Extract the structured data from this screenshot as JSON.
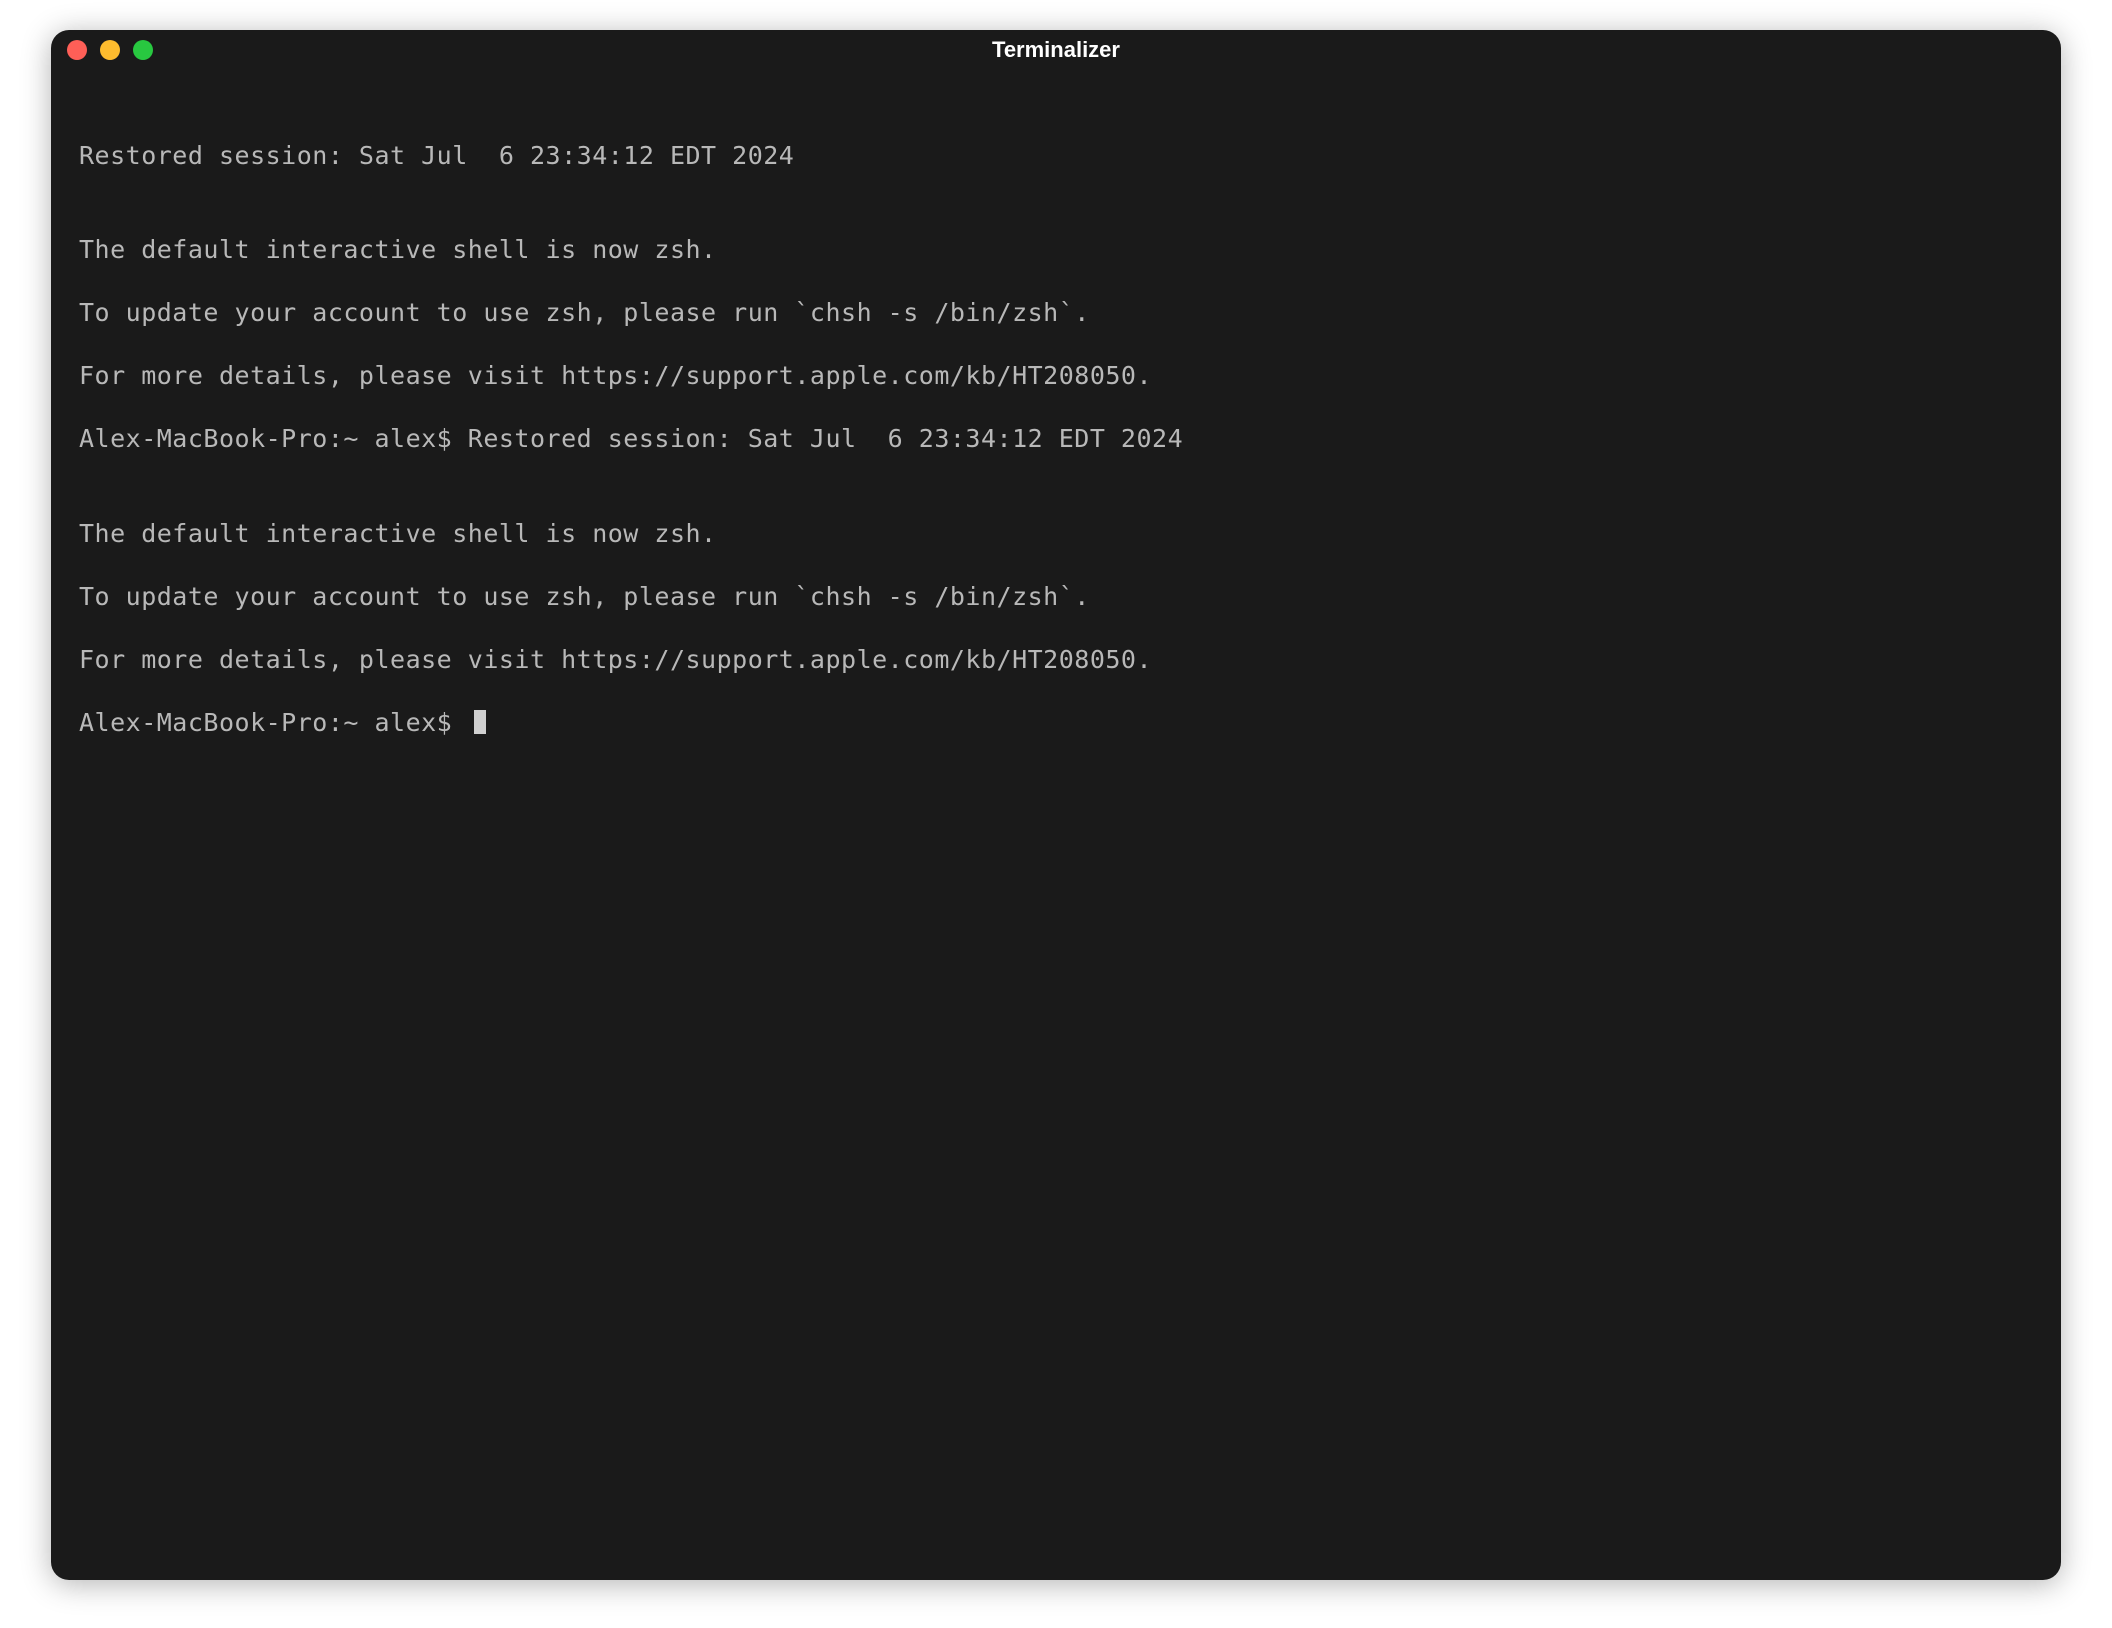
{
  "window": {
    "title": "Terminalizer"
  },
  "terminal": {
    "lines": [
      "Restored session: Sat Jul  6 23:34:12 EDT 2024",
      "",
      "The default interactive shell is now zsh.",
      "To update your account to use zsh, please run `chsh -s /bin/zsh`.",
      "For more details, please visit https://support.apple.com/kb/HT208050.",
      "Alex-MacBook-Pro:~ alex$ Restored session: Sat Jul  6 23:34:12 EDT 2024",
      "",
      "The default interactive shell is now zsh.",
      "To update your account to use zsh, please run `chsh -s /bin/zsh`.",
      "For more details, please visit https://support.apple.com/kb/HT208050."
    ],
    "prompt": "Alex-MacBook-Pro:~ alex$ "
  }
}
